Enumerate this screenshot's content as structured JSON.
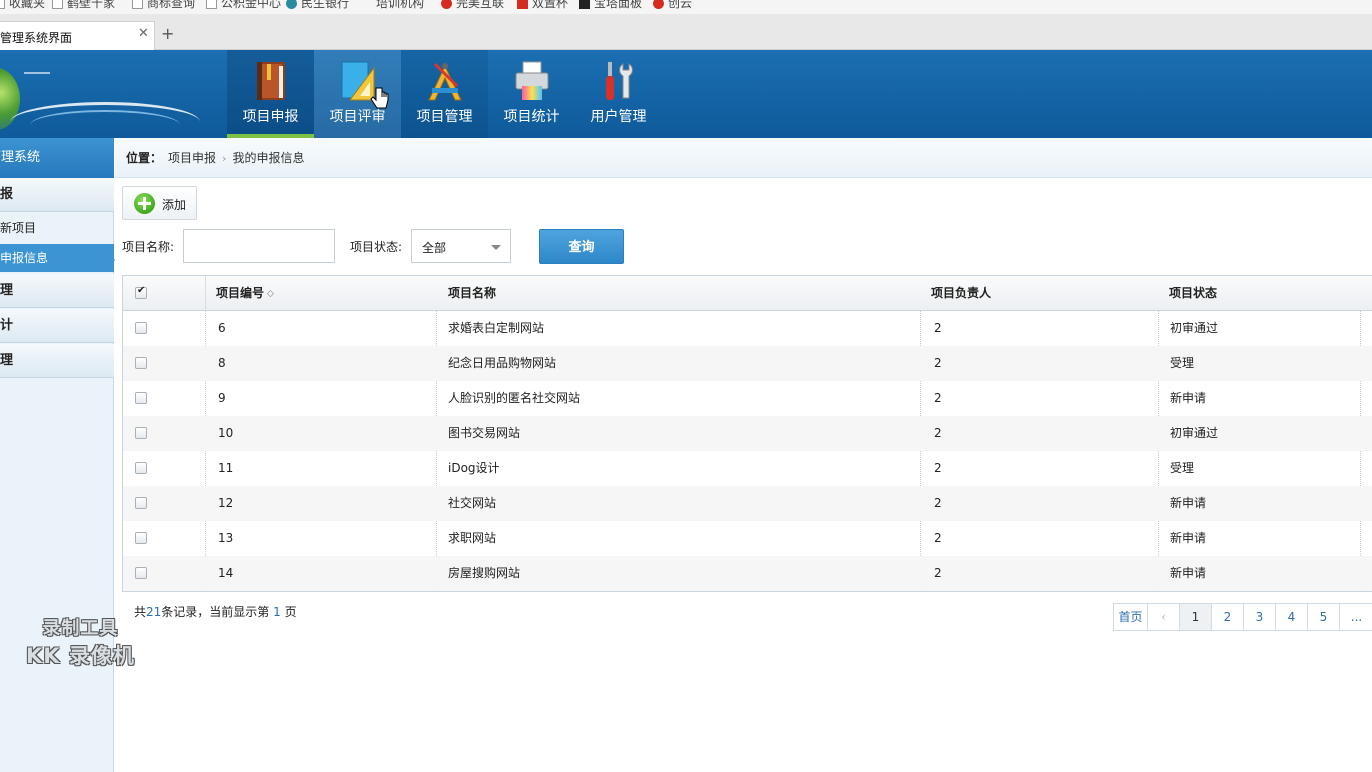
{
  "browser": {
    "bookmarks": [
      {
        "label": "收藏夹",
        "icon": "page-icon"
      },
      {
        "label": "鹤壁千家",
        "icon": "page-icon"
      },
      {
        "label": "商标查询",
        "icon": "page-icon"
      },
      {
        "label": "公积金中心",
        "icon": "page-icon"
      },
      {
        "label": "民生银行",
        "icon": "bank-icon"
      },
      {
        "label": "培训机构",
        "icon": "none"
      },
      {
        "label": "完美互联",
        "icon": "brand-icon"
      },
      {
        "label": "双置杯",
        "icon": "cup-icon"
      },
      {
        "label": "宝塔面板",
        "icon": "bt-icon"
      },
      {
        "label": "创云",
        "icon": "cloud-icon"
      }
    ],
    "tab_title": "管理系统界面",
    "close_glyph": "✕",
    "new_tab_glyph": "+"
  },
  "header": {
    "nav": [
      {
        "label": "项目申报",
        "icon": "book-icon",
        "state": "active"
      },
      {
        "label": "项目评审",
        "icon": "ruler-triangle-icon",
        "state": "hover"
      },
      {
        "label": "项目管理",
        "icon": "drafting-compass-icon",
        "state": "hover2"
      },
      {
        "label": "项目统计",
        "icon": "printer-icon",
        "state": ""
      },
      {
        "label": "用户管理",
        "icon": "tools-icon",
        "state": ""
      }
    ]
  },
  "sidebar": {
    "title": "管理系统",
    "groups": [
      {
        "label": "报"
      },
      {
        "label": "新项目"
      },
      {
        "label": "申报信息"
      },
      {
        "label": "理"
      },
      {
        "label": "计"
      },
      {
        "label": "理"
      }
    ]
  },
  "watermark": {
    "line1": "录制工具",
    "line2": "KK 录像机"
  },
  "breadcrumb": {
    "label": "位置：",
    "items": [
      "项目申报",
      "我的申报信息"
    ],
    "sep": "›"
  },
  "toolbar": {
    "add_label": "添加"
  },
  "filters": {
    "name_label": "项目名称:",
    "name_value": "",
    "status_label": "项目状态:",
    "status_value": "全部",
    "query_label": "查询"
  },
  "table": {
    "columns": [
      "项目编号",
      "项目名称",
      "项目负责人",
      "项目状态"
    ],
    "sort_glyph": "◇",
    "rows": [
      {
        "id": "6",
        "name": "求婚表白定制网站",
        "owner": "2",
        "status": "初审通过"
      },
      {
        "id": "8",
        "name": "纪念日用品购物网站",
        "owner": "2",
        "status": "受理"
      },
      {
        "id": "9",
        "name": "人脸识别的匿名社交网站",
        "owner": "2",
        "status": "新申请"
      },
      {
        "id": "10",
        "name": "图书交易网站",
        "owner": "2",
        "status": "初审通过"
      },
      {
        "id": "11",
        "name": "iDog设计",
        "owner": "2",
        "status": "受理"
      },
      {
        "id": "12",
        "name": "社交网站",
        "owner": "2",
        "status": "新申请"
      },
      {
        "id": "13",
        "name": "求职网站",
        "owner": "2",
        "status": "新申请"
      },
      {
        "id": "14",
        "name": "房屋搜购网站",
        "owner": "2",
        "status": "新申请"
      }
    ]
  },
  "summary": {
    "prefix": "共",
    "count": "21",
    "mid": "条记录，当前显示第",
    "page": "1",
    "suffix": "页"
  },
  "pager": {
    "first": "首页",
    "prev": "‹",
    "pages": [
      "1",
      "2",
      "3",
      "4",
      "5"
    ],
    "more": "..."
  },
  "colors": {
    "header_blue": "#1b6fb2",
    "active_green": "#7dc243",
    "side_active": "#3a95d2",
    "link_blue": "#2a6fb3"
  }
}
